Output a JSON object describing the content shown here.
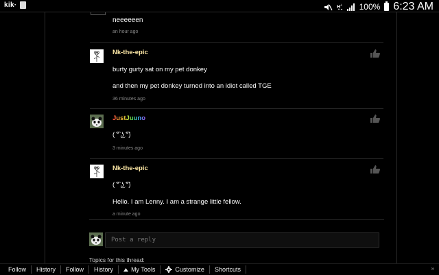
{
  "status_bar": {
    "app_label": "kik·",
    "battery": "100%",
    "time": "6:23 AM"
  },
  "thread": {
    "previous": {
      "text": "neeeeeen",
      "time": "an hour ago"
    },
    "comments": [
      {
        "username": "Nk-the-epic",
        "lines": [
          "burty gurty sat on my pet donkey",
          "and then my pet donkey turned into an idiot called TGE"
        ],
        "time": "36 minutes ago"
      },
      {
        "username": "JustJuuno",
        "lines": [
          "( ͡° ͜ʖ ͡°)"
        ],
        "time": "3 minutes ago"
      },
      {
        "username": "Nk-the-epic",
        "lines": [
          "( ͡° ͜ʖ ͡°)",
          "Hello. I am Lenny. I am a strange little fellow."
        ],
        "time": "a minute ago"
      }
    ],
    "reply_placeholder": "Post a reply",
    "topics_label": "Topics for this thread:"
  },
  "toolbar": {
    "items": [
      "Follow",
      "History",
      "Follow",
      "History",
      "My Tools",
      "Customize",
      "Shortcuts"
    ]
  }
}
